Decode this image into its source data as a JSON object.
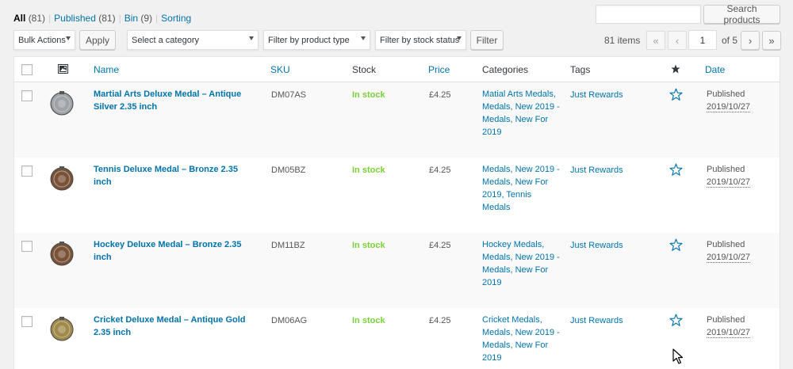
{
  "views": {
    "all": {
      "label": "All",
      "count": "(81)"
    },
    "published": {
      "label": "Published",
      "count": "(81)"
    },
    "bin": {
      "label": "Bin",
      "count": "(9)"
    },
    "sorting": {
      "label": "Sorting"
    },
    "separator": "|"
  },
  "search": {
    "placeholder": "",
    "button": "Search products"
  },
  "tablenav": {
    "bulk_actions": "Bulk Actions",
    "apply": "Apply",
    "category": "Select a category",
    "product_type": "Filter by product type",
    "stock_status": "Filter by stock status",
    "filter": "Filter",
    "items": "81 items",
    "first": "«",
    "prev": "‹",
    "page": "1",
    "of_total": "of 5",
    "next": "›",
    "last": "»"
  },
  "columns": {
    "name": "Name",
    "sku": "SKU",
    "stock": "Stock",
    "price": "Price",
    "categories": "Categories",
    "tags": "Tags",
    "date": "Date"
  },
  "rows": [
    {
      "name": "Martial Arts Deluxe Medal – Antique Silver 2.35 inch",
      "sku": "DM07AS",
      "stock": "In stock",
      "price": "£4.25",
      "categories": "Matial Arts Medals, Medals, New 2019 - Medals, New For 2019",
      "tags": "Just Rewards",
      "status": "Published",
      "date": "2019/10/27",
      "medal_color": "#9ea3a8"
    },
    {
      "name": "Tennis Deluxe Medal – Bronze 2.35 inch",
      "sku": "DM05BZ",
      "stock": "In stock",
      "price": "£4.25",
      "categories": "Medals, New 2019 - Medals, New For 2019, Tennis Medals",
      "tags": "Just Rewards",
      "status": "Published",
      "date": "2019/10/27",
      "medal_color": "#7a5238"
    },
    {
      "name": "Hockey Deluxe Medal – Bronze 2.35 inch",
      "sku": "DM11BZ",
      "stock": "In stock",
      "price": "£4.25",
      "categories": "Hockey Medals, Medals, New 2019 - Medals, New For 2019",
      "tags": "Just Rewards",
      "status": "Published",
      "date": "2019/10/27",
      "medal_color": "#7a5238"
    },
    {
      "name": "Cricket Deluxe Medal – Antique Gold 2.35 inch",
      "sku": "DM06AG",
      "stock": "In stock",
      "price": "£4.25",
      "categories": "Cricket Medals, Medals, New 2019 - Medals, New For 2019",
      "tags": "Just Rewards",
      "status": "Published",
      "date": "2019/10/27",
      "medal_color": "#a08a4a"
    }
  ]
}
